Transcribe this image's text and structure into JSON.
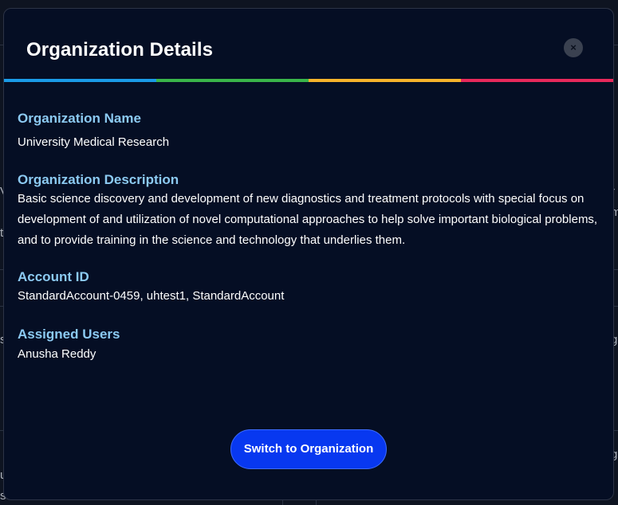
{
  "modal": {
    "title": "Organization Details",
    "close_glyph": "×",
    "accent_colors": [
      "#1a9be8",
      "#3ab54a",
      "#f7b32b",
      "#e8295b"
    ]
  },
  "fields": {
    "org_name_label": "Organization Name",
    "org_name_value": "University Medical Research",
    "org_desc_label": "Organization Description",
    "org_desc_value": "Basic science discovery and development of new diagnostics and treatment protocols with special focus on development of and utilization of novel computational approaches to help solve important biological problems, and to provide training in the science and technology that underlies them.",
    "account_id_label": "Account ID",
    "account_id_value": "StandardAccount-0459, uhtest1, StandardAccount",
    "assigned_users_label": "Assigned Users",
    "assigned_users_value": "Anusha Reddy"
  },
  "actions": {
    "switch_label": "Switch to Organization"
  },
  "background": {
    "fragments": [
      "V",
      "ti",
      "r",
      "m",
      "g",
      "s",
      "g",
      "u",
      "s"
    ]
  }
}
